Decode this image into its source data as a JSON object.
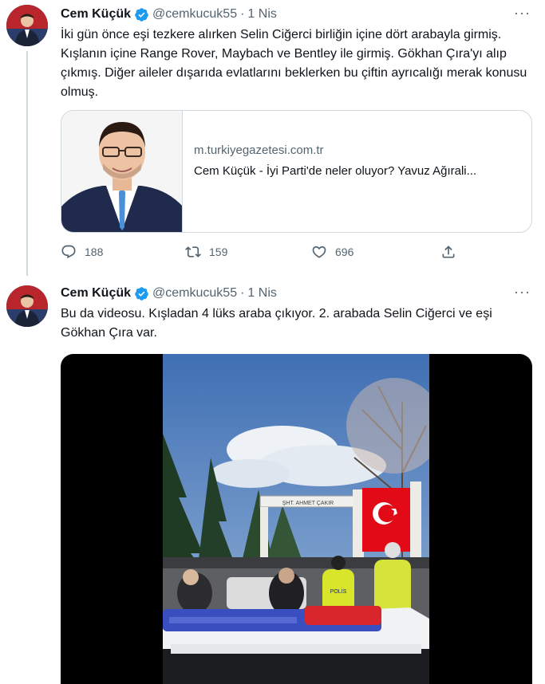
{
  "tweets": [
    {
      "author_name": "Cem Küçük",
      "author_handle": "@cemkucuk55",
      "separator": "·",
      "time": "1 Nis",
      "more": "···",
      "text": "İki gün önce eşi tezkere alırken Selin Ciğerci birliğin içine dört arabayla girmiş. Kışlanın içine Range Rover, Maybach ve Bentley ile girmiş. Gökhan Çıra'yı alıp çıkmış. Diğer aileler dışarıda evlatlarını beklerken bu çiftin ayrıcalığı merak konusu olmuş.",
      "card": {
        "domain": "m.turkiyegazetesi.com.tr",
        "title": "Cem Küçük - İyi Parti'de neler oluyor? Yavuz Ağırali..."
      },
      "replies": "188",
      "retweets": "159",
      "likes": "696"
    },
    {
      "author_name": "Cem Küçük",
      "author_handle": "@cemkucuk55",
      "separator": "·",
      "time": "1 Nis",
      "more": "···",
      "text": "Bu da videosu. Kışladan 4 lüks araba çıkıyor. 2. arabada Selin Ciğerci ve eşi Gökhan Çıra var.",
      "video": {
        "gate_sign": "ŞHT. AHMET ÇAKIR",
        "vest_label": "POLİS"
      }
    }
  ],
  "colors": {
    "text": "#0f1419",
    "secondary": "#536471",
    "border": "#cfd9de",
    "verified": "#1d9bf0",
    "flag_red": "#e30a17"
  },
  "icons": [
    "verified-badge-icon",
    "reply-icon",
    "retweet-icon",
    "like-icon",
    "share-icon",
    "more-icon"
  ]
}
